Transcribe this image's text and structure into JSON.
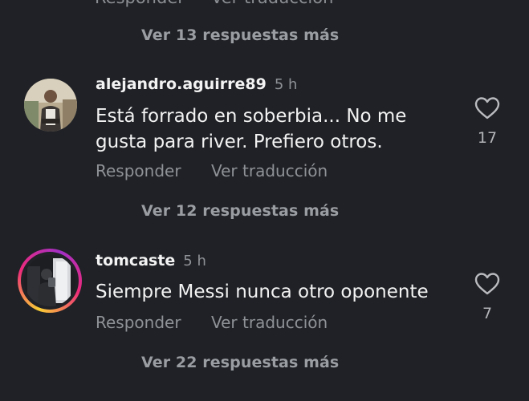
{
  "top_partial": {
    "reply_label": "Responder",
    "translate_label": "Ver traducción"
  },
  "thread1": {
    "more_replies": "Ver 13 respuestas más"
  },
  "comments": [
    {
      "username": "alejandro.aguirre89",
      "time": "5 h",
      "text_line1": "Está forrado en soberbia... No me",
      "text_line2": "gusta para river. Prefiero otros.",
      "likes": "17",
      "reply_label": "Responder",
      "translate_label": "Ver traducción",
      "more_replies": "Ver 12 respuestas más"
    },
    {
      "username": "tomcaste",
      "time": "5 h",
      "text_line1": "Siempre Messi nunca otro oponente",
      "likes": "7",
      "reply_label": "Responder",
      "translate_label": "Ver traducción",
      "more_replies": "Ver 22 respuestas más"
    }
  ],
  "colors": {
    "background": "#1f2126",
    "secondary_text": "#8f9297",
    "story_ring": "#ee2a7b"
  },
  "icons": [
    "heart-outline-icon",
    "avatar"
  ]
}
